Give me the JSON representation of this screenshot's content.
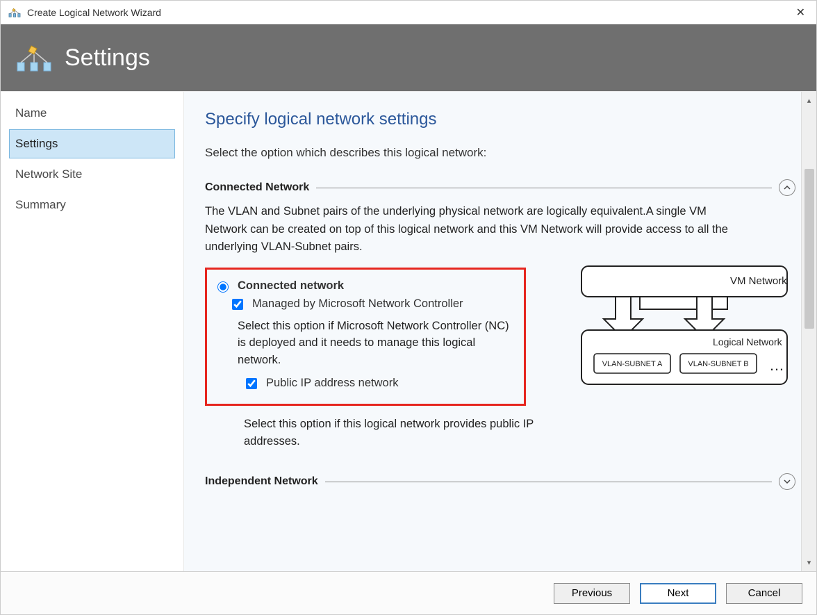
{
  "window": {
    "title": "Create Logical Network Wizard",
    "close_glyph": "✕"
  },
  "header": {
    "title": "Settings"
  },
  "sidebar": {
    "items": [
      {
        "label": "Name",
        "selected": false
      },
      {
        "label": "Settings",
        "selected": true
      },
      {
        "label": "Network Site",
        "selected": false
      },
      {
        "label": "Summary",
        "selected": false
      }
    ]
  },
  "page": {
    "title": "Specify logical network settings",
    "instruction": "Select the option which describes this logical network:",
    "connected": {
      "group_label": "Connected Network",
      "desc": "The VLAN and Subnet pairs of the underlying physical network are logically equivalent.A single VM Network can be created on top of this logical network and this VM Network will provide access to all the underlying VLAN-Subnet pairs.",
      "radio_label": "Connected network",
      "radio_checked": true,
      "managed_label": "Managed by Microsoft Network Controller",
      "managed_checked": true,
      "managed_desc": "Select this option if Microsoft Network Controller (NC) is deployed and it needs to manage this logical network.",
      "public_ip_label": "Public IP address network",
      "public_ip_checked": true,
      "public_ip_desc": "Select this option if this logical network provides public IP addresses."
    },
    "independent": {
      "group_label": "Independent Network"
    },
    "diagram": {
      "vm_network": "VM Network",
      "logical_network": "Logical  Network",
      "vlan_a": "VLAN-SUBNET A",
      "vlan_b": "VLAN-SUBNET B",
      "ellipsis": "…"
    }
  },
  "footer": {
    "previous": "Previous",
    "next": "Next",
    "cancel": "Cancel"
  },
  "scroll": {
    "up_glyph": "▴",
    "down_glyph": "▾"
  }
}
